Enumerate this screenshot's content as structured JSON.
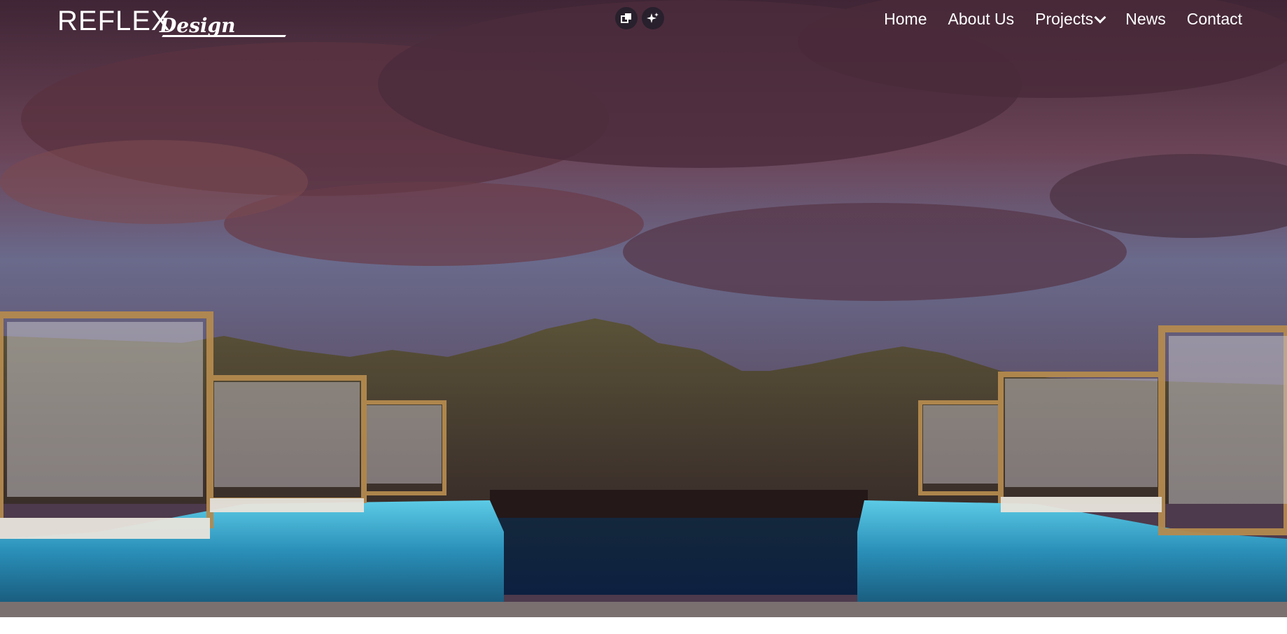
{
  "brand": {
    "name": "REFLEX",
    "tagline": "Design"
  },
  "nav": {
    "items": [
      {
        "label": "Home"
      },
      {
        "label": "About Us"
      },
      {
        "label": "Projects"
      },
      {
        "label": "News"
      },
      {
        "label": "Contact"
      }
    ]
  },
  "tools": {
    "copy_icon": "copy-icon",
    "sparkle_icon": "sparkle-icon"
  },
  "colors": {
    "text": "#ffffff",
    "sky_top": "#4a2a3a",
    "sky_mid": "#6a5a78",
    "pool": "#3bb0d4"
  }
}
